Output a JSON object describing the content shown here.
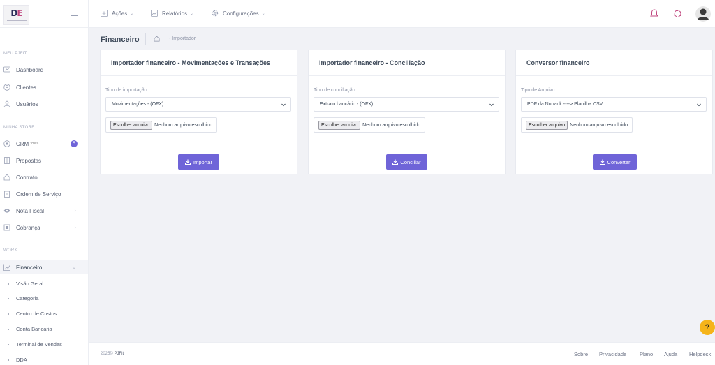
{
  "brand": {
    "logo_text_d": "D",
    "logo_text_e": "E"
  },
  "sidebar": {
    "section_meu": "MEU PJFIT",
    "meu_items": [
      "Dashboard",
      "Clientes",
      "Usuários"
    ],
    "section_store": "MINHA STORE",
    "crm": {
      "label": "CRM",
      "beta": "*Beta",
      "badge": "5"
    },
    "store_items": [
      "Propostas",
      "Contrato",
      "Ordem de Serviço",
      "Nota Fiscal",
      "Cobrança"
    ],
    "section_work": "WORK",
    "financeiro": "Financeiro",
    "sub_items": [
      "Visão Geral",
      "Categoria",
      "Centro de Custos",
      "Conta Bancaria",
      "Terminal de Vendas",
      "DDA"
    ]
  },
  "topbar": {
    "menu": [
      "Ações",
      "Relatórios",
      "Configurações"
    ]
  },
  "page": {
    "title": "Financeiro",
    "breadcrumb": "Importador"
  },
  "cards": [
    {
      "title": "Importador financeiro - Movimentações e Transações",
      "label": "Tipo de importação:",
      "select": "Movimentações - (OFX)",
      "file_button": "Escolher arquivo",
      "file_status": "Nenhum arquivo escolhido",
      "action": "Importar"
    },
    {
      "title": "Importador financeiro - Conciliação",
      "label": "Tipo de conciliação:",
      "select": "Extrato bancário - (OFX)",
      "file_button": "Escolher arquivo",
      "file_status": "Nenhum arquivo escolhido",
      "action": "Conciliar"
    },
    {
      "title": "Conversor financeiro",
      "label": "Tipo de Arquivo:",
      "select": "PDF da Nubank ----> Planilha CSV",
      "file_button": "Escolher arquivo",
      "file_status": "Nenhum arquivo escolhido",
      "action": "Converter"
    }
  ],
  "footer": {
    "year": "2025©",
    "brand": "PJFit",
    "links": [
      "Sobre",
      "Privacidade",
      "Plano",
      "Ajuda",
      "Helpdesk"
    ]
  },
  "help_fab": "?",
  "colors": {
    "accent": "#6f64d8",
    "help": "#f5b41a",
    "alert": "#c0477f"
  }
}
